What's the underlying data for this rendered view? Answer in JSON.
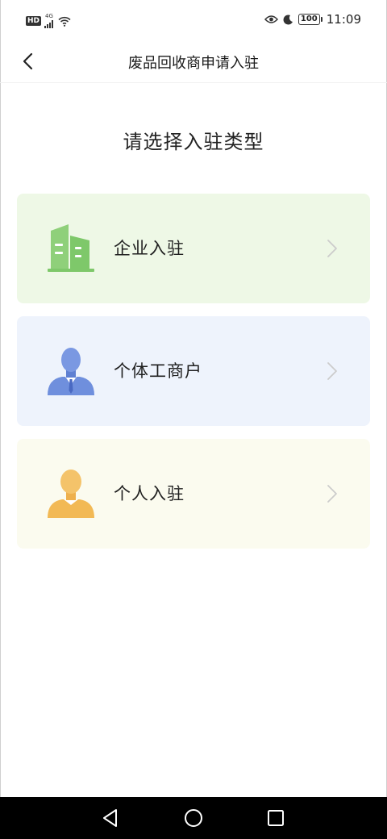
{
  "status_bar": {
    "hd": "HD",
    "network": "4G",
    "battery": "100",
    "time": "11:09"
  },
  "header": {
    "title": "废品回收商申请入驻"
  },
  "page": {
    "heading": "请选择入驻类型"
  },
  "options": [
    {
      "label": "企业入驻",
      "icon": "building-icon",
      "bg": "#eef8e6",
      "icon_color": "#7ec86a"
    },
    {
      "label": "个体工商户",
      "icon": "businessman-icon",
      "bg": "#eef3fc",
      "icon_color": "#6f8fdd"
    },
    {
      "label": "个人入驻",
      "icon": "person-icon",
      "bg": "#fbfbef",
      "icon_color": "#f2c063"
    }
  ],
  "colors": {
    "chevron": "#cccccc",
    "nav_bg": "#000000"
  }
}
